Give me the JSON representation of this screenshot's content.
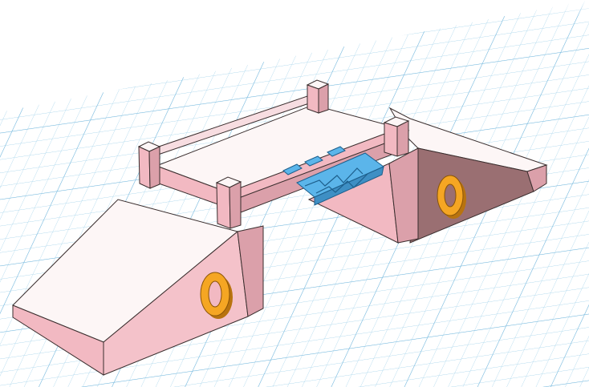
{
  "viewport": {
    "title": "",
    "workplane": {
      "grid": "on",
      "grid_color": "#9fd0e8",
      "major_grid_color": "#6fb6dc",
      "background": "#ffffff"
    }
  },
  "model": {
    "name": "",
    "face_colors": {
      "top": "#fdf6f6",
      "side_light": "#f2b9c2",
      "side_mid": "#dba0aa",
      "side_dark": "#9a6f72",
      "outline": "#3a2e2e"
    },
    "score_left": {
      "text": "0",
      "color": "#f5a623"
    },
    "score_right": {
      "text": "0",
      "color": "#f5a623"
    },
    "center_part": {
      "color": "#5bb5ea",
      "labels": [
        "",
        "",
        ""
      ]
    }
  }
}
